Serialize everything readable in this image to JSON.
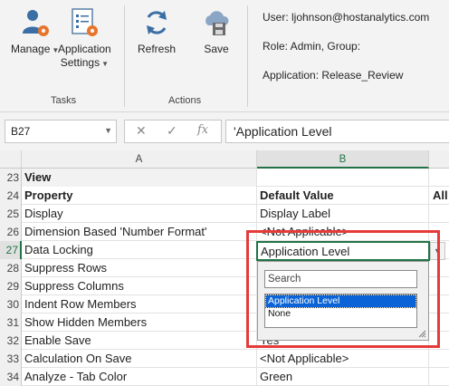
{
  "ribbon": {
    "tasks": {
      "group_label": "Tasks",
      "manage": {
        "label": "Manage",
        "icon": "user-gear-icon"
      },
      "app_settings": {
        "line1": "Application",
        "line2": "Settings",
        "icon": "settings-list-icon"
      }
    },
    "actions": {
      "group_label": "Actions",
      "refresh": {
        "label": "Refresh",
        "icon": "refresh-icon"
      },
      "save": {
        "label": "Save",
        "icon": "cloud-save-icon"
      }
    },
    "info": {
      "user": "User: ljohnson@hostanalytics.com",
      "role": "Role: Admin, Group:",
      "application": "Application: Release_Review"
    }
  },
  "formula_bar": {
    "name_box": "B27",
    "fx_symbol": "fx",
    "content": "'Application Level"
  },
  "columns": {
    "a": "A",
    "b": "B"
  },
  "rows": [
    {
      "num": "23",
      "a": "View",
      "b": "",
      "c": "",
      "a_bold": true
    },
    {
      "num": "24",
      "a": "Property",
      "b": "Default Value",
      "c": "All",
      "a_bold": true,
      "b_bold": true,
      "c_bold": true
    },
    {
      "num": "25",
      "a": "Display",
      "b": "Display Label",
      "c": ""
    },
    {
      "num": "26",
      "a": "Dimension Based 'Number Format'",
      "b": "<Not Applicable>",
      "c": ""
    },
    {
      "num": "27",
      "a": "Data Locking",
      "b": "Application Level",
      "c": ""
    },
    {
      "num": "28",
      "a": "Suppress Rows",
      "b": "",
      "c": ""
    },
    {
      "num": "29",
      "a": "Suppress Columns",
      "b": "",
      "c": ""
    },
    {
      "num": "30",
      "a": "Indent Row Members",
      "b": "",
      "c": ""
    },
    {
      "num": "31",
      "a": "Show Hidden Members",
      "b": "",
      "c": ""
    },
    {
      "num": "32",
      "a": "Enable Save",
      "b": "Yes",
      "c": ""
    },
    {
      "num": "33",
      "a": "Calculation On Save",
      "b": "<Not Applicable>",
      "c": ""
    },
    {
      "num": "34",
      "a": "Analyze - Tab Color",
      "b": "Green",
      "c": ""
    }
  ],
  "active_cell": {
    "value": "Application Level"
  },
  "dropdown": {
    "search_placeholder": "Search",
    "options": [
      "Application Level",
      "None"
    ],
    "selected": "Application Level"
  },
  "colors": {
    "excel_green": "#217346",
    "highlight_red": "#e53b3b",
    "selection_blue": "#0a64d8"
  }
}
